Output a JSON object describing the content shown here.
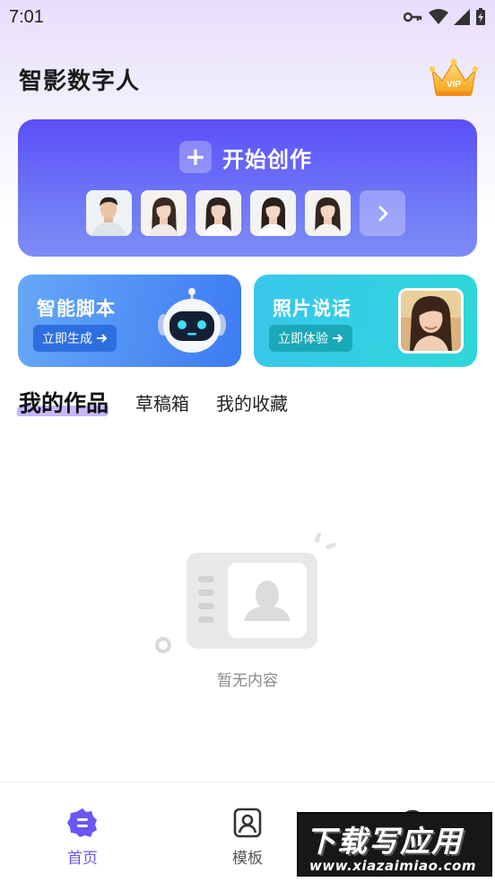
{
  "status_bar": {
    "time": "7:01"
  },
  "header": {
    "title": "智影数字人",
    "vip_label": "VIP"
  },
  "banner": {
    "start_label": "开始创作",
    "plus_glyph": "+",
    "avatars": [
      "avatar-male-1",
      "avatar-female-1",
      "avatar-female-2",
      "avatar-female-3",
      "avatar-female-4"
    ]
  },
  "cards": {
    "script": {
      "title": "智能脚本",
      "button": "立即生成"
    },
    "photo": {
      "title": "照片说话",
      "button": "立即体验"
    }
  },
  "tabs": [
    {
      "label": "我的作品",
      "active": true
    },
    {
      "label": "草稿箱",
      "active": false
    },
    {
      "label": "我的收藏",
      "active": false
    }
  ],
  "empty_state": {
    "text": "暂无内容"
  },
  "bottom_nav": {
    "items": [
      {
        "label": "首页",
        "icon": "home-icon",
        "active": true
      },
      {
        "label": "模板",
        "icon": "template-icon",
        "active": false
      },
      {
        "label": "",
        "icon": "mine-icon",
        "active": false
      }
    ]
  },
  "watermark": {
    "title": "下载写应用",
    "url": "www.xiazaimiao.com"
  },
  "colors": {
    "accent": "#6a55f5",
    "banner_top": "#5b4ef8",
    "card_script": "#3d7bf3",
    "card_photo": "#2ed7d9"
  }
}
